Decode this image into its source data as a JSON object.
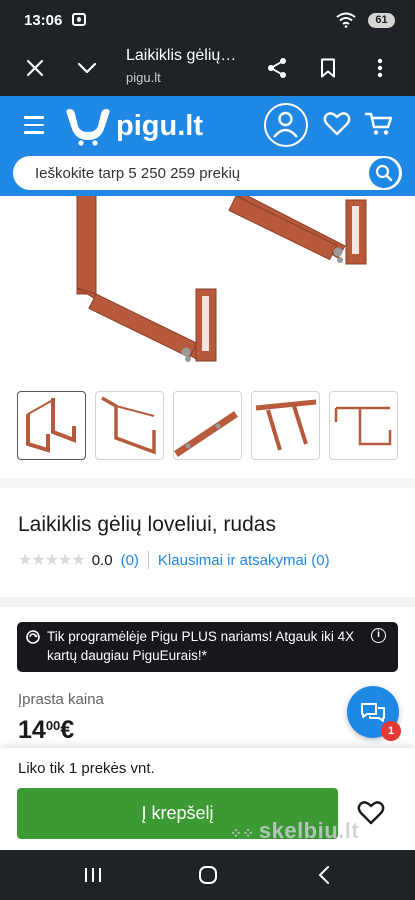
{
  "status_bar": {
    "time": "13:06",
    "battery": "61"
  },
  "browser": {
    "title": "Laikiklis gėlių…",
    "url": "pigu.lt"
  },
  "site": {
    "logo": "pigu.lt",
    "search_placeholder": "Ieškokite tarp 5 250 259 prekių"
  },
  "product": {
    "title": "Laikiklis gėlių loveliui, rudas",
    "rating_value": "0.0",
    "rating_count": "(0)",
    "qa_link": "Klausimai ir atsakymai (0)",
    "stars": 0,
    "thumbnail_count": 5
  },
  "promo": {
    "text": "Tik programėlėje Pigu PLUS nariams! Atgauk iki 4X kartų daugiau PiguEurais!*"
  },
  "price": {
    "label": "Įprasta kaina",
    "whole": "14",
    "cents": "00",
    "currency": "€"
  },
  "chat": {
    "badge": "1"
  },
  "bottom": {
    "stock": "Liko tik 1 prekės vnt.",
    "add_to_cart": "Į krepšelį",
    "watermark": "skelbiu.lt"
  },
  "colors": {
    "brand": "#1f88e5",
    "cart_button": "#3c9a34",
    "bracket": "#b75a3c"
  }
}
